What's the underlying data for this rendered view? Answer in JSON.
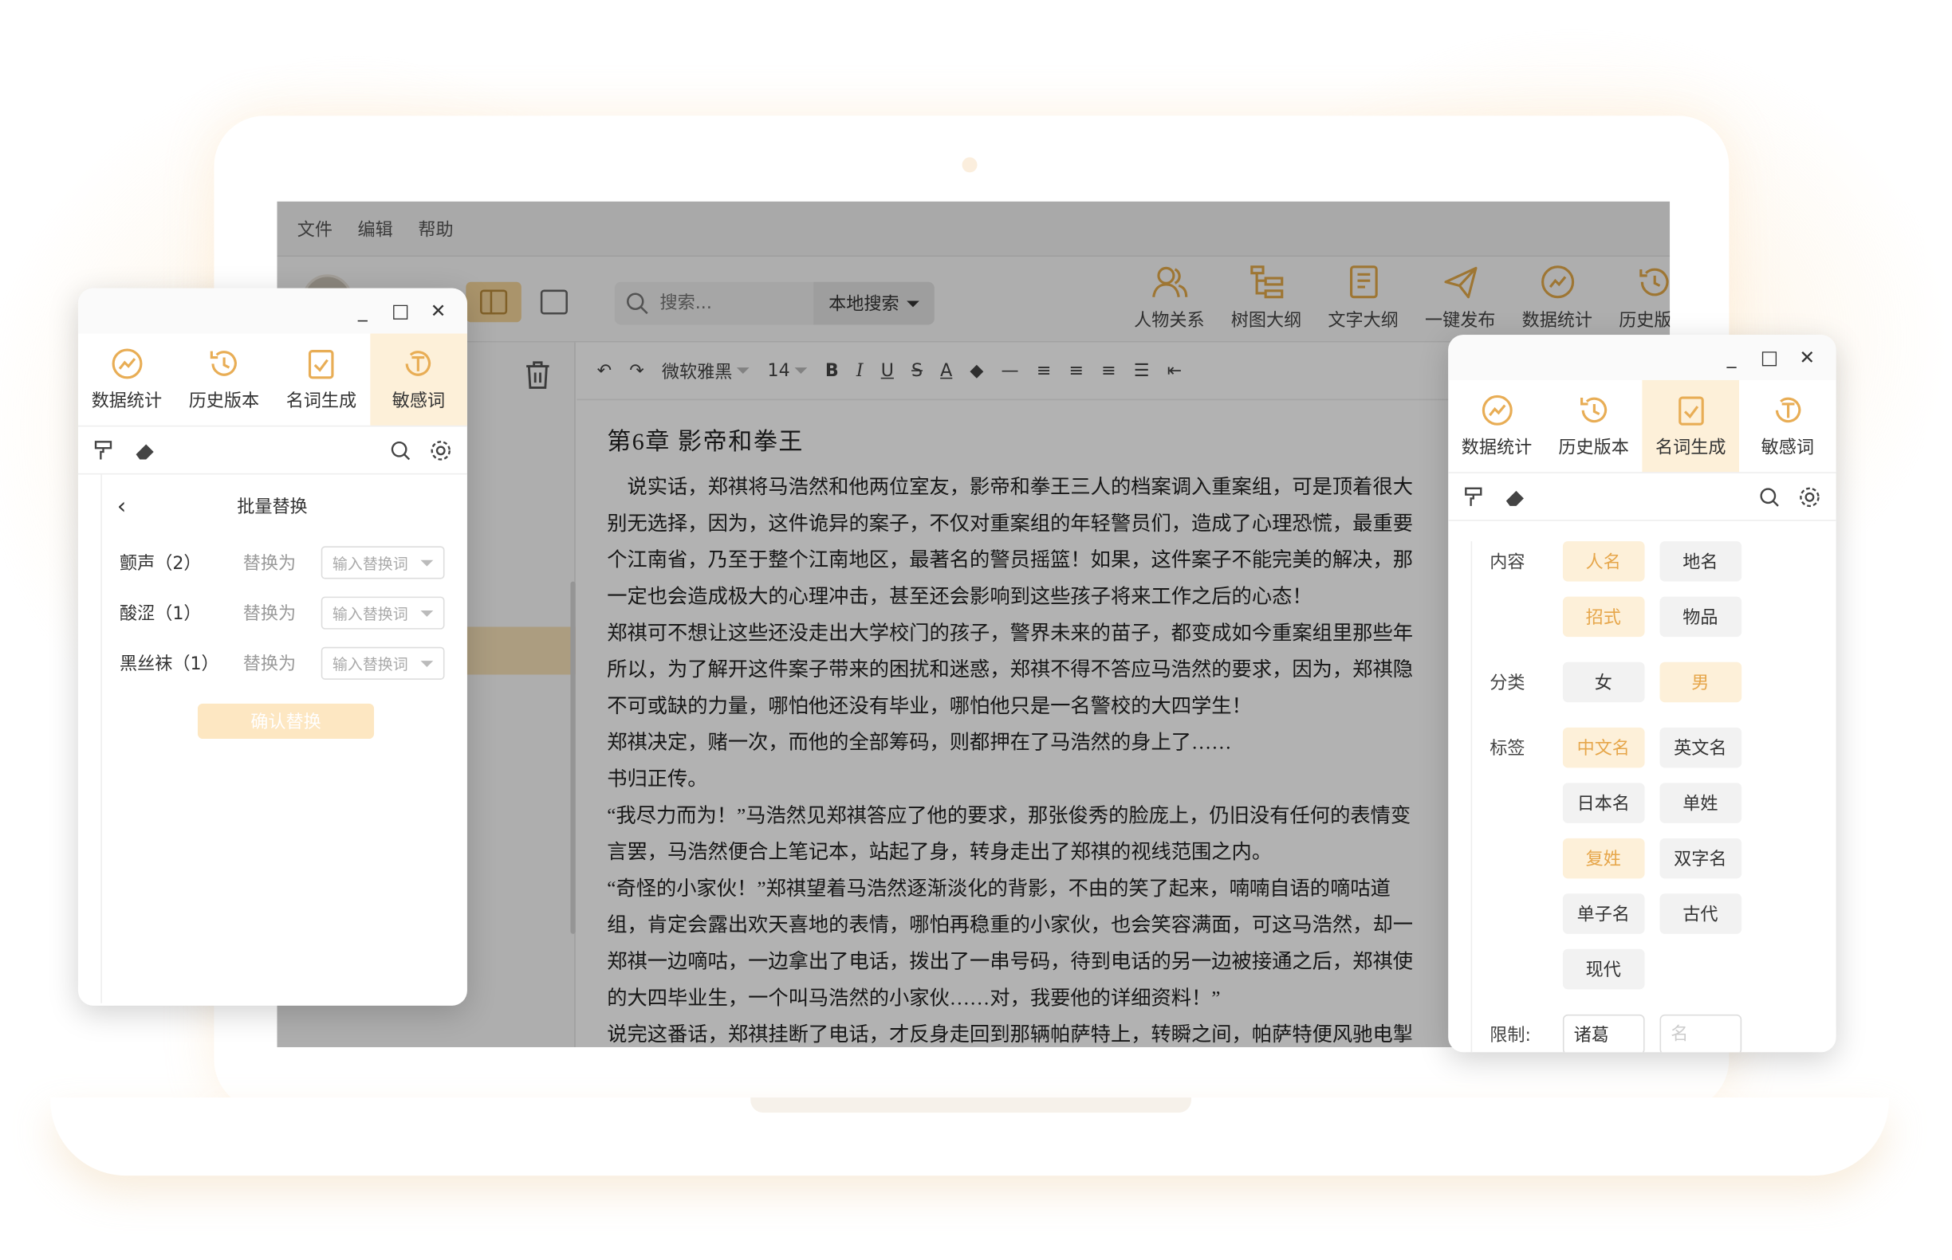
{
  "menubar": {
    "file": "文件",
    "edit": "编辑",
    "help": "帮助"
  },
  "toolbar": {
    "search_placeholder": "搜索...",
    "search_scope": "本地搜索",
    "tools": [
      {
        "label": "人物关系",
        "icon": "people-icon"
      },
      {
        "label": "树图大纲",
        "icon": "tree-outline-icon"
      },
      {
        "label": "文字大纲",
        "icon": "text-outline-icon"
      },
      {
        "label": "一键发布",
        "icon": "publish-icon"
      },
      {
        "label": "数据统计",
        "icon": "chart-icon"
      },
      {
        "label": "历史版本",
        "icon": "history-icon"
      }
    ]
  },
  "format": {
    "font": "微软雅黑",
    "size": "14"
  },
  "editor": {
    "chapter_title": "第6章  影帝和拳王",
    "paragraphs": [
      "    说实话，郑祺将马浩然和他两位室友，影帝和拳王三人的档案调入重案组，可是顶着很大",
      "别无选择，因为，这件诡异的案子，不仅对重案组的年轻警员们，造成了心理恐慌，最重要",
      "个江南省，乃至于整个江南地区，最著名的警员摇篮！如果，这件案子不能完美的解决，那",
      "一定也会造成极大的心理冲击，甚至还会影响到这些孩子将来工作之后的心态！",
      "郑祺可不想让这些还没走出大学校门的孩子，警界未来的苗子，都变成如今重案组里那些年",
      "所以，为了解开这件案子带来的困扰和迷惑，郑祺不得不答应马浩然的要求，因为，郑祺隐",
      "不可或缺的力量，哪怕他还没有毕业，哪怕他只是一名警校的大四学生！",
      "郑祺决定，赌一次，而他的全部筹码，则都押在了马浩然的身上了……",
      "书归正传。",
      "“我尽力而为！”马浩然见郑祺答应了他的要求，那张俊秀的脸庞上，仍旧没有任何的表情变",
      "言罢，马浩然便合上笔记本，站起了身，转身走出了郑祺的视线范围之内。",
      "“奇怪的小家伙！”郑祺望着马浩然逐渐淡化的背影，不由的笑了起来，喃喃自语的嘀咕道",
      "组，肯定会露出欢天喜地的表情，哪怕再稳重的小家伙，也会笑容满面，可这马浩然，却一",
      "郑祺一边嘀咕，一边拿出了电话，拨出了一串号码，待到电话的另一边被接通之后，郑祺使",
      "的大四毕业生，一个叫马浩然的小家伙……对，我要他的详细资料！”",
      "说完这番话，郑祺挂断了电话，才反身走回到那辆帕萨特上，转瞬之间，帕萨特便风驰电掣"
    ]
  },
  "left_panel": {
    "tabs": [
      "数据统计",
      "历史版本",
      "名词生成",
      "敏感词"
    ],
    "active_tab": 3,
    "title": "批量替换",
    "replace_label": "替换为",
    "input_placeholder": "输入替换词",
    "rows": [
      {
        "word": "颤声（2）"
      },
      {
        "word": "酸涩（1）"
      },
      {
        "word": "黑丝袜（1）"
      }
    ],
    "confirm": "确认替换"
  },
  "right_panel": {
    "tabs": [
      "数据统计",
      "历史版本",
      "名词生成",
      "敏感词"
    ],
    "active_tab": 2,
    "content_label": "内容",
    "content": [
      "人名",
      "地名",
      "招式",
      "物品"
    ],
    "category_label": "分类",
    "category": [
      "女",
      "男"
    ],
    "tag_label": "标签",
    "tags": [
      "中文名",
      "英文名",
      "日本名",
      "单姓",
      "复姓",
      "双字名",
      "单子名",
      "古代",
      "现代"
    ],
    "limit_label": "限制:",
    "limit_value": "诸葛",
    "limit_placeholder": "名"
  }
}
